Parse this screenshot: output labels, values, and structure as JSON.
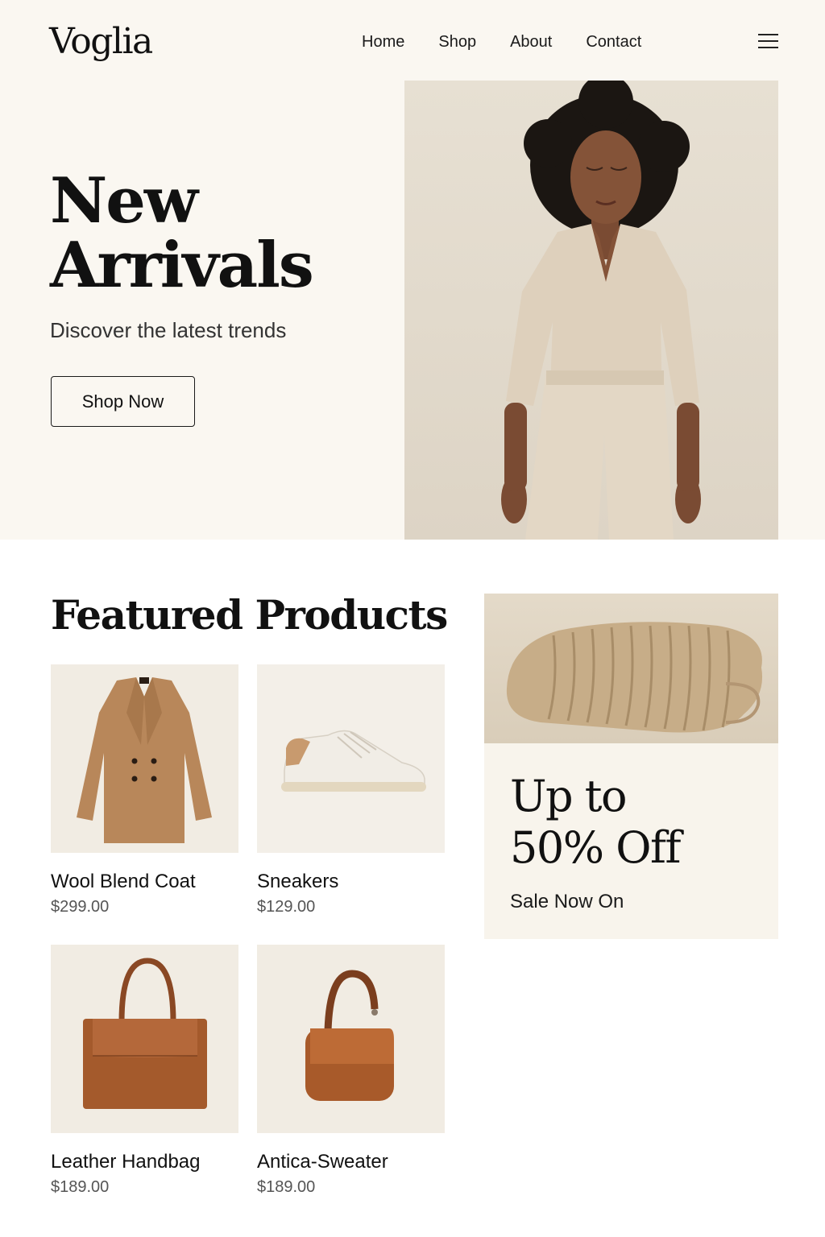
{
  "brand": {
    "name": "Voglia"
  },
  "nav": {
    "items": [
      "Home",
      "Shop",
      "About",
      "Contact"
    ]
  },
  "menu": {
    "icon": "hamburger-menu-icon"
  },
  "hero": {
    "title": "New\nArrivals",
    "subtitle": "Discover the latest trends",
    "cta_label": "Shop Now",
    "image": "woman-in-beige-linen-outfit-photo"
  },
  "featured": {
    "title": "Featured Products",
    "products": [
      {
        "name": "Wool Blend Coat",
        "price": "$299.00",
        "image": "camel-coat-photo"
      },
      {
        "name": "Sneakers",
        "price": "$129.00",
        "image": "white-sneaker-photo"
      },
      {
        "name": "Leather Handbag",
        "price": "$189.00",
        "image": "brown-leather-handbag-photo"
      },
      {
        "name": "Antica-Sweater",
        "price": "$189.00",
        "image": "brown-shoulder-bag-photo"
      }
    ]
  },
  "promo": {
    "title": "Up to\n50% Off",
    "subtitle": "Sale Now On",
    "image": "folded-knit-sweater-photo"
  },
  "colors": {
    "page_bg": "#ffffff",
    "hero_bg": "#faf7f1",
    "text": "#111111",
    "muted_text": "#555555",
    "product_bg": "#f1ece3",
    "accent_camel": "#b8875a",
    "accent_leather": "#a45a2c"
  }
}
